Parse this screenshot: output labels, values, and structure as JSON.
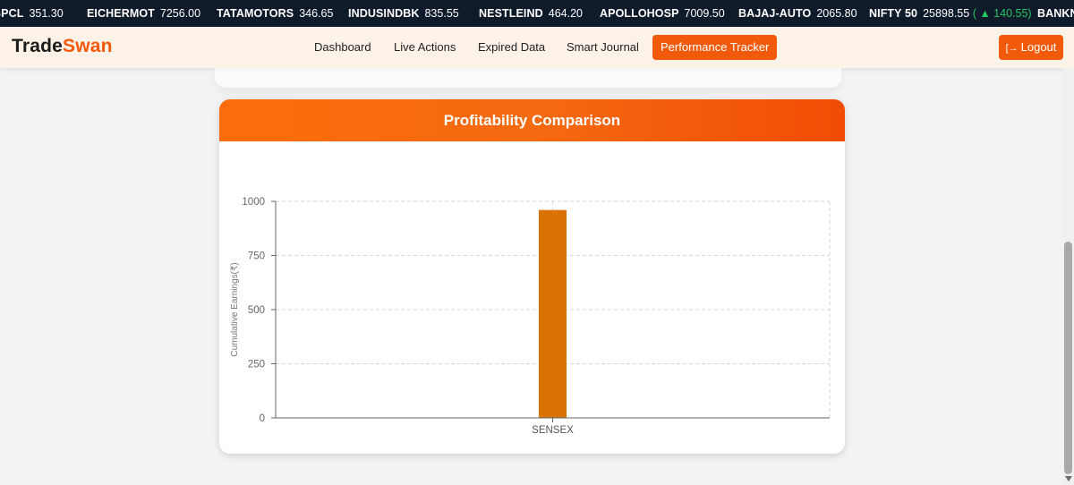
{
  "ticker": {
    "items": [
      {
        "symbol": "BPCL",
        "price": "351.30"
      },
      {
        "symbol": "EICHERMOT",
        "price": "7256.00"
      },
      {
        "symbol": "TATAMOTORS",
        "price": "346.65"
      },
      {
        "symbol": "INDUSINDBK",
        "price": "835.55"
      },
      {
        "symbol": "NESTLEIND",
        "price": "464.20"
      },
      {
        "symbol": "APOLLOHOSP",
        "price": "7009.50"
      },
      {
        "symbol": "BAJAJ-AUTO",
        "price": "2065.80"
      },
      {
        "symbol": "NIFTY 50",
        "price": "25898.55",
        "change": "( ▲ 140.55)"
      },
      {
        "symbol": "BANKNIFTY",
        "price": ""
      }
    ]
  },
  "navbar": {
    "brand_main": "Trade",
    "brand_accent": "Swan",
    "items": [
      {
        "label": "Dashboard"
      },
      {
        "label": "Live Actions"
      },
      {
        "label": "Expired Data"
      },
      {
        "label": "Smart Journal"
      },
      {
        "label": "Performance Tracker",
        "active": true
      }
    ],
    "logout_label": "Logout",
    "logout_icon": "logout-icon"
  },
  "card": {
    "title": "Profitability Comparison"
  },
  "colors": {
    "accent": "#f05a0a",
    "bar": "#d97306",
    "ticker_bg": "#0f1a2b",
    "positive": "#22c55e"
  },
  "chart_data": {
    "type": "bar",
    "title": "",
    "categories": [
      "SENSEX"
    ],
    "values": [
      960
    ],
    "ylabel": "Cumulative Earnings(₹)",
    "xlabel": "",
    "ylim": [
      0,
      1000
    ],
    "yticks": [
      0,
      250,
      500,
      750,
      1000
    ],
    "grid": true,
    "legend": "none"
  }
}
